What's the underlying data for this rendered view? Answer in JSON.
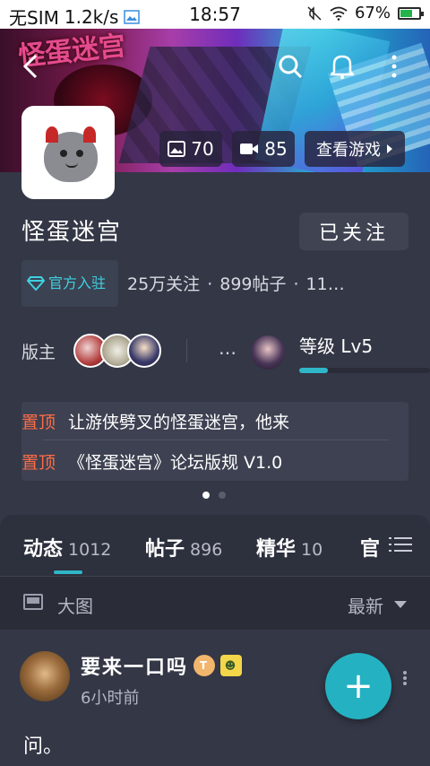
{
  "status_bar": {
    "carrier": "无SIM",
    "speed": "1.2k/s",
    "time": "18:57",
    "battery": "67%",
    "battery_level": 0.67
  },
  "banner": {
    "title": "怪蛋迷宫",
    "photos_count": "70",
    "videos_count": "85",
    "view_game_label": "查看游戏"
  },
  "forum": {
    "name": "怪蛋迷宫",
    "follow_label": "已关注",
    "official_label": "官方入驻",
    "followers": "25万关注",
    "posts": "899帖子",
    "extra": "11…"
  },
  "moderators": {
    "label": "版主",
    "ellipsis": "…",
    "level_label": "等级 Lv5",
    "level_progress": 0.22
  },
  "pinned": [
    {
      "tag": "置顶",
      "text": "让游侠劈叉的怪蛋迷宫，他来"
    },
    {
      "tag": "置顶",
      "text": "《怪蛋迷宫》论坛版规 V1.0"
    }
  ],
  "tabs": [
    {
      "label": "动态",
      "count": "1012"
    },
    {
      "label": "帖子",
      "count": "896"
    },
    {
      "label": "精华",
      "count": "10"
    },
    {
      "label": "官",
      "count": ""
    }
  ],
  "filter": {
    "view_label": "大图",
    "sort_label": "最新"
  },
  "post": {
    "username": "要来一口吗",
    "badge1": "T",
    "badge2": "☻",
    "time": "6小时前",
    "text": "问。"
  },
  "fab": {
    "symbol": "+"
  },
  "colors": {
    "background": "#343746",
    "accent": "#24b2c2",
    "pinned_tag": "#ff6b45",
    "official": "#3fd0e0"
  }
}
